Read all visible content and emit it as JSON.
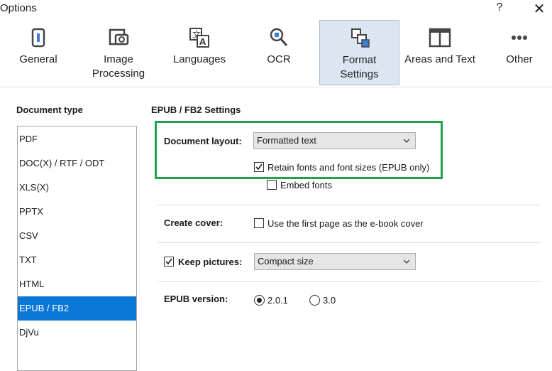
{
  "window": {
    "title": "Options",
    "help_label": "?",
    "close_label": "✕"
  },
  "toolbar": {
    "items": [
      {
        "label": "General",
        "icon": "general-icon"
      },
      {
        "label": "Image\nProcessing",
        "icon": "image-processing-icon"
      },
      {
        "label": "Languages",
        "icon": "languages-icon"
      },
      {
        "label": "OCR",
        "icon": "ocr-icon"
      },
      {
        "label": "Format\nSettings",
        "icon": "format-settings-icon",
        "active": true
      },
      {
        "label": "Areas and Text",
        "icon": "areas-text-icon"
      },
      {
        "label": "Other",
        "icon": "more-icon"
      }
    ]
  },
  "document_type": {
    "title": "Document type",
    "items": [
      "PDF",
      "DOC(X) / RTF / ODT",
      "XLS(X)",
      "PPTX",
      "CSV",
      "TXT",
      "HTML",
      "EPUB / FB2",
      "DjVu"
    ],
    "selected": "EPUB / FB2"
  },
  "settings": {
    "title": "EPUB / FB2 Settings",
    "document_layout": {
      "label": "Document layout:",
      "value": "Formatted text"
    },
    "retain_fonts": {
      "label": "Retain fonts and font sizes (EPUB only)",
      "checked": true
    },
    "embed_fonts": {
      "label": "Embed fonts",
      "checked": false
    },
    "create_cover": {
      "label": "Create cover:",
      "checkbox_label": "Use the first page as the e-book cover",
      "checked": false
    },
    "keep_pictures": {
      "label": "Keep pictures:",
      "checked": true,
      "value": "Compact size"
    },
    "epub_version": {
      "label": "EPUB version:",
      "options": [
        "2.0.1",
        "3.0"
      ],
      "selected": "2.0.1"
    }
  },
  "colors": {
    "selection": "#0b78d7",
    "active_tab": "#dbe6f1",
    "highlight": "#1fa34a"
  }
}
